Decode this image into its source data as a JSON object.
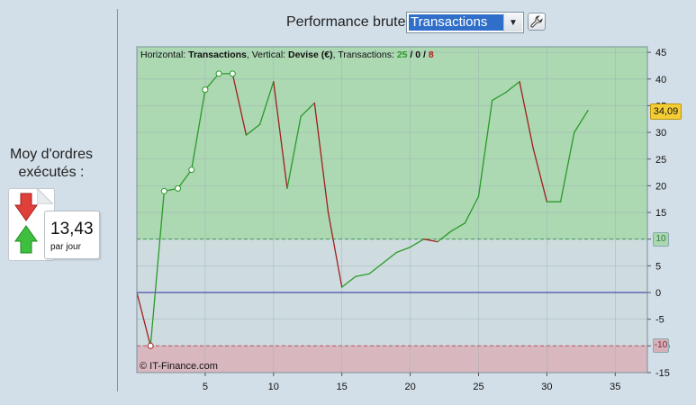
{
  "left_panel": {
    "moy_label_line1": "Moy d'ordres",
    "moy_label_line2": "exécutés :",
    "moy_value": "13,43",
    "moy_unit": "par jour"
  },
  "header": {
    "title": "Performance brute",
    "select_value": "Transactions",
    "select_arrow": "▼",
    "wrench_icon": "wrench-icon"
  },
  "chart_info": {
    "h_label": "Horizontal: ",
    "h_value": "Transactions",
    "v_label": ", Vertical: ",
    "v_value": "Devise (€)",
    "t_label": ", Transactions: ",
    "t_green": "25",
    "sep1": " / ",
    "t_black": "0",
    "sep2": " / ",
    "t_red": "8"
  },
  "copyright": "© IT-Finance.com",
  "last_value_badge": "34,09",
  "upper_threshold_badge": "10",
  "lower_threshold_badge": "-10",
  "colors": {
    "zone_green": "#acd8b2",
    "zone_red": "#d9b7bf",
    "zone_mid": "#cedcdf",
    "line_up": "#2a9a2a",
    "line_down": "#a01e1e",
    "zero_line": "#2a2aa0",
    "last_badge": "#f4cd35"
  },
  "chart_data": {
    "type": "line",
    "x": [
      0,
      1,
      2,
      3,
      4,
      5,
      6,
      7,
      8,
      9,
      10,
      11,
      12,
      13,
      14,
      15,
      16,
      17,
      18,
      19,
      20,
      21,
      22,
      23,
      24,
      25,
      26,
      27,
      28,
      29,
      30,
      31,
      32,
      33
    ],
    "y": [
      0,
      -10,
      19,
      19.5,
      23,
      38,
      41,
      41,
      29.5,
      31.5,
      39.5,
      19.5,
      33,
      35.5,
      15,
      1,
      3,
      3.5,
      5.5,
      7.5,
      8.5,
      10,
      9.5,
      11.5,
      13,
      18,
      36,
      37.5,
      39.5,
      27,
      17,
      17,
      30,
      34.09
    ],
    "marked_points": [
      1,
      2,
      3,
      4,
      5,
      6,
      7
    ],
    "xlim": [
      0,
      37
    ],
    "ylim": [
      -15,
      45
    ],
    "xticks": [
      5,
      10,
      15,
      20,
      25,
      30,
      35
    ],
    "yticks": [
      -15,
      -10,
      -5,
      0,
      5,
      10,
      15,
      20,
      25,
      30,
      35,
      40,
      45
    ],
    "upper_threshold": 10,
    "lower_threshold": -10,
    "xlabel": "Transactions",
    "ylabel": "Devise (€)",
    "grid": true
  }
}
